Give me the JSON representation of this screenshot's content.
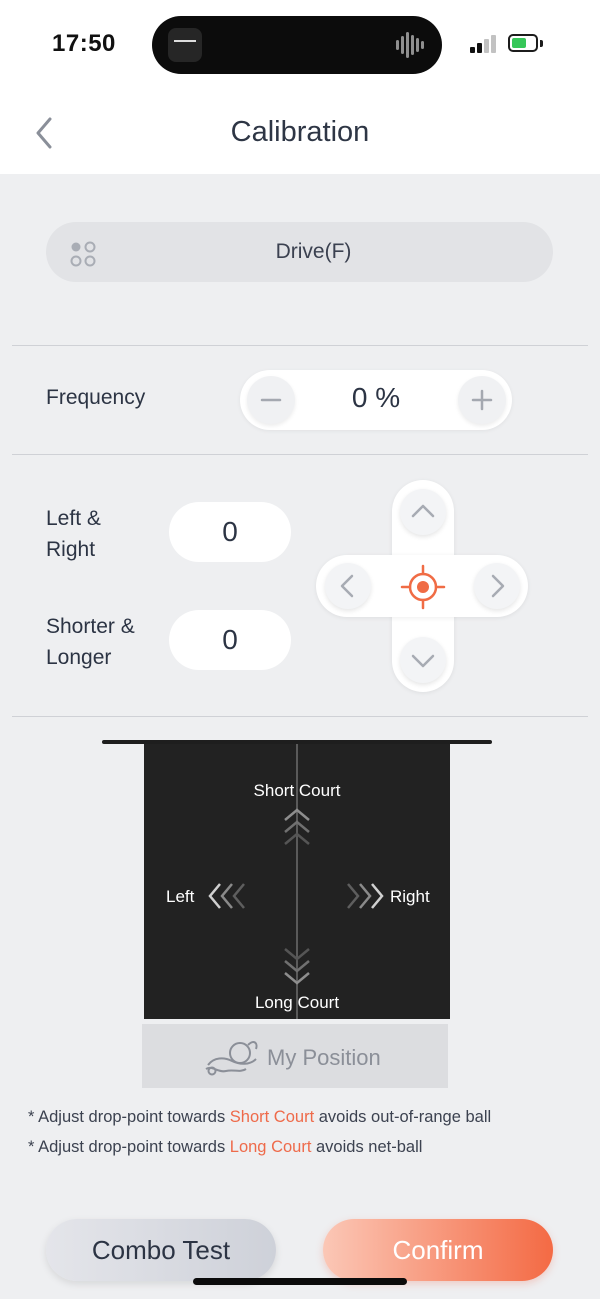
{
  "status_bar": {
    "time": "17:50"
  },
  "header": {
    "title": "Calibration"
  },
  "mode": {
    "label": "Drive(F)"
  },
  "frequency": {
    "label": "Frequency",
    "value": "0 %"
  },
  "offsets": {
    "left_right_line1": "Left &",
    "left_right_line2": "Right",
    "left_right_value": "0",
    "shorter_longer_line1": "Shorter &",
    "shorter_longer_line2": "Longer",
    "shorter_longer_value": "0"
  },
  "court": {
    "short": "Short Court",
    "long": "Long Court",
    "left": "Left",
    "right": "Right",
    "my_position": "My Position"
  },
  "notes": {
    "note1_prefix": "* Adjust drop-point towards ",
    "note1_highlight": "Short Court",
    "note1_suffix": " avoids out-of-range ball",
    "note2_prefix": "* Adjust drop-point towards ",
    "note2_highlight": "Long Court",
    "note2_suffix": " avoids net-ball"
  },
  "buttons": {
    "combo": "Combo Test",
    "confirm": "Confirm"
  },
  "colors": {
    "accent": "#f46a44",
    "accent_light": "#fbc7b6",
    "text": "#2c3444",
    "background": "#eeeff1"
  },
  "icons": {
    "back": "chevron-left-icon",
    "mode": "four-dots-icon",
    "minus": "minus-icon",
    "plus": "plus-icon",
    "up": "chevron-up-icon",
    "down": "chevron-down-icon",
    "left": "chevron-left-icon",
    "right": "chevron-right-icon",
    "center": "crosshair-icon",
    "player": "player-icon"
  }
}
